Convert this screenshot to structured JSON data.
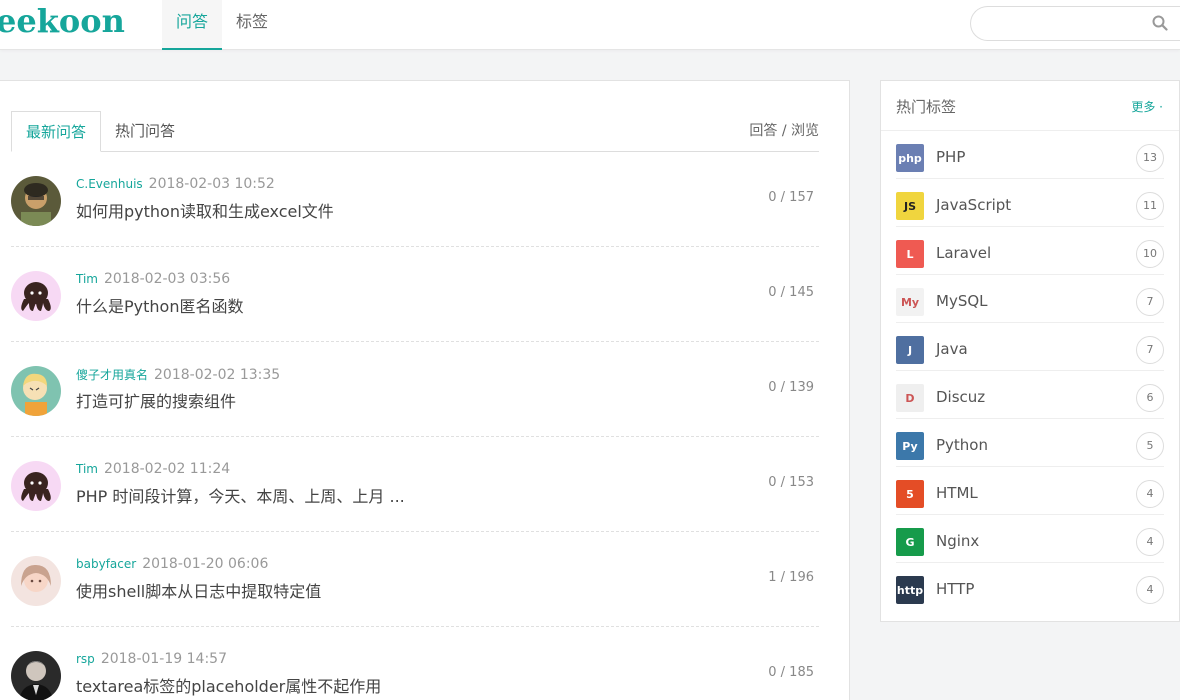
{
  "header": {
    "logo": "eekoon",
    "nav": [
      {
        "label": "问答",
        "active": true
      },
      {
        "label": "标签",
        "active": false
      }
    ],
    "search": {
      "placeholder": "",
      "icon": "search-icon"
    }
  },
  "main": {
    "tabs": [
      {
        "label": "最新问答",
        "active": true
      },
      {
        "label": "热门问答",
        "active": false
      }
    ],
    "stats_header": "回答 / 浏览",
    "questions": [
      {
        "user": "C.Evenhuis",
        "time": "2018-02-03 10:52",
        "title": "如何用python读取和生成excel文件",
        "stats": "0 / 157"
      },
      {
        "user": "Tim",
        "time": "2018-02-03 03:56",
        "title": "什么是Python匿名函数",
        "stats": "0 / 145"
      },
      {
        "user": "傻子才用真名",
        "time": "2018-02-02 13:35",
        "title": "打造可扩展的搜索组件",
        "stats": "0 / 139"
      },
      {
        "user": "Tim",
        "time": "2018-02-02 11:24",
        "title": "PHP 时间段计算，今天、本周、上周、上月 ...",
        "stats": "0 / 153"
      },
      {
        "user": "babyfacer",
        "time": "2018-01-20 06:06",
        "title": "使用shell脚本从日志中提取特定值",
        "stats": "1 / 196"
      },
      {
        "user": "rsp",
        "time": "2018-01-19 14:57",
        "title": "textarea标签的placeholder属性不起作用",
        "stats": "0 / 185"
      }
    ]
  },
  "sidebar": {
    "title": "热门标签",
    "more": "更多 ·",
    "tags": [
      {
        "name": "PHP",
        "count": "13",
        "icon": "php-icon",
        "color": "#6b7fb3",
        "glyph": "php"
      },
      {
        "name": "JavaScript",
        "count": "11",
        "icon": "javascript-icon",
        "color": "#f0d53e",
        "glyph": "JS"
      },
      {
        "name": "Laravel",
        "count": "10",
        "icon": "laravel-icon",
        "color": "#ef5a52",
        "glyph": "L"
      },
      {
        "name": "MySQL",
        "count": "7",
        "icon": "mysql-icon",
        "color": "#f2f2f2",
        "glyph": "My"
      },
      {
        "name": "Java",
        "count": "7",
        "icon": "java-icon",
        "color": "#4f6fa0",
        "glyph": "J"
      },
      {
        "name": "Discuz",
        "count": "6",
        "icon": "discuz-icon",
        "color": "#efefef",
        "glyph": "D"
      },
      {
        "name": "Python",
        "count": "5",
        "icon": "python-icon",
        "color": "#3c78aa",
        "glyph": "Py"
      },
      {
        "name": "HTML",
        "count": "4",
        "icon": "html-icon",
        "color": "#e44d26",
        "glyph": "5"
      },
      {
        "name": "Nginx",
        "count": "4",
        "icon": "nginx-icon",
        "color": "#169b4b",
        "glyph": "G"
      },
      {
        "name": "HTTP",
        "count": "4",
        "icon": "http-icon",
        "color": "#2b3a4f",
        "glyph": "http"
      }
    ]
  }
}
